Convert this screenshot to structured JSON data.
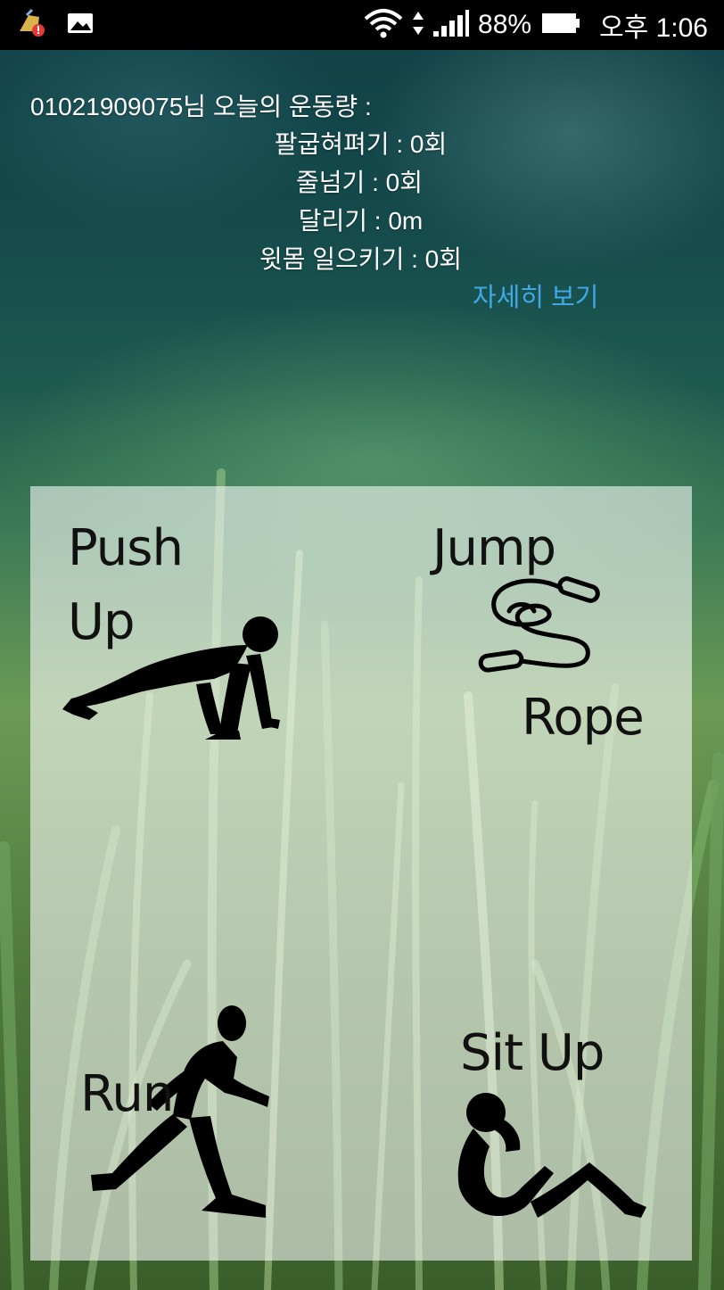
{
  "status_bar": {
    "left_icons": [
      "cleaner-app-icon",
      "gallery-icon"
    ],
    "right_icons": [
      "wifi-icon",
      "data-arrows-icon",
      "signal-icon",
      "battery-icon"
    ],
    "battery_percent": "88%",
    "time": "오후 1:06"
  },
  "summary": {
    "title": "01021909075님 오늘의 운동량 :",
    "stats": [
      "팔굽혀펴기 : 0회",
      "줄넘기 : 0회",
      "달리기 : 0m",
      "윗몸 일으키기 : 0회"
    ],
    "detail_link": "자세히 보기"
  },
  "exercises": {
    "pushup": {
      "label_line1": "Push",
      "label_line2": "Up",
      "icon": "pushup-figure-icon"
    },
    "jumprope": {
      "label_line1": "Jump",
      "label_line2": "Rope",
      "icon": "jump-rope-icon"
    },
    "run": {
      "label": "Run",
      "icon": "runner-figure-icon"
    },
    "situp": {
      "label": "Sit Up",
      "icon": "situp-figure-icon"
    }
  },
  "colors": {
    "status_bar": "#000000",
    "link": "#3fa9e8",
    "panel_overlay": "rgba(255,255,255,0.58)"
  }
}
